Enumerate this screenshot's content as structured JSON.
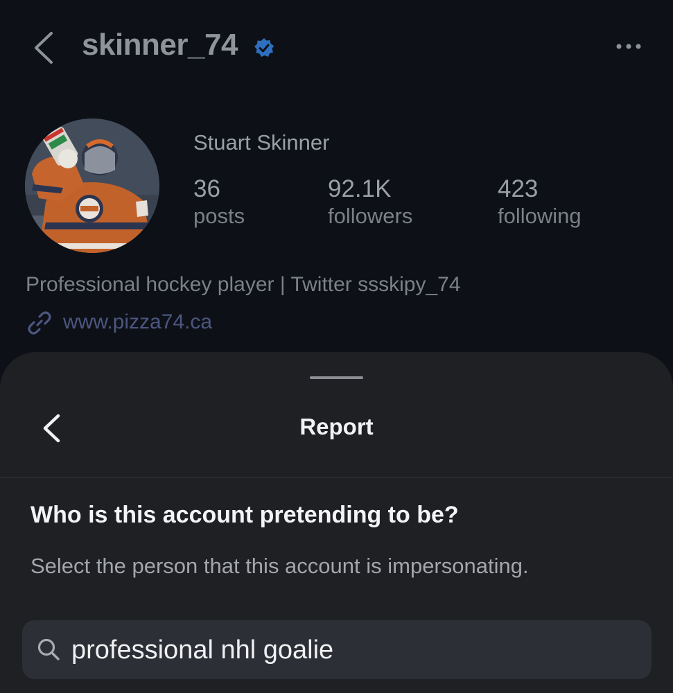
{
  "header": {
    "username": "skinner_74",
    "verified": true,
    "back_icon": "chevron-left-icon",
    "more_icon": "more-horizontal-icon"
  },
  "profile": {
    "full_name": "Stuart Skinner",
    "stats": [
      {
        "value": "36",
        "label": "posts"
      },
      {
        "value": "92.1K",
        "label": "followers"
      },
      {
        "value": "423",
        "label": "following"
      }
    ],
    "bio": "Professional hockey player | Twitter ssskipy_74",
    "link": "www.pizza74.ca",
    "link_icon": "link-icon"
  },
  "report_sheet": {
    "title": "Report",
    "question": "Who is this account pretending to be?",
    "subtext": "Select the person that this account is impersonating.",
    "search": {
      "value": "professional nhl goalie",
      "icon": "search-icon"
    }
  },
  "colors": {
    "background": "#0d1016",
    "sheet": "#1f2024",
    "search_field": "#2d2f37",
    "verified_badge": "#2e6fbf",
    "link": "#4c5680"
  }
}
